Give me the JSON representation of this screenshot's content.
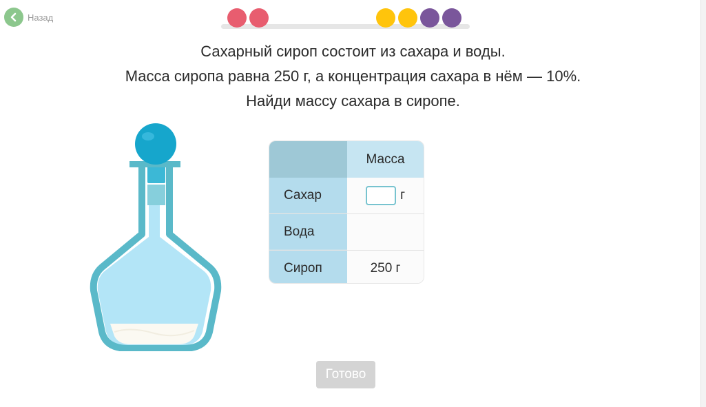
{
  "nav": {
    "back_label": "Назад"
  },
  "progress": {
    "dots": [
      {
        "color": "#e85d6f",
        "state": "incorrect"
      },
      {
        "color": "#e85d6f",
        "state": "incorrect"
      },
      {
        "color": "#ffc40c",
        "state": "correct"
      },
      {
        "color": "#ffc40c",
        "state": "correct"
      },
      {
        "color": "#7a569b",
        "state": "current"
      },
      {
        "color": "#7a569b",
        "state": "current"
      }
    ]
  },
  "task": {
    "line1": "Сахарный сироп состоит из сахара и воды.",
    "line2": "Масса сиропа равна 250 г, а концентрация сахара в нём — 10%.",
    "line3": "Найди массу сахара в сиропе."
  },
  "table": {
    "header": "Масса",
    "rows": [
      {
        "label": "Сахар",
        "value": "",
        "unit": "г"
      },
      {
        "label": "Вода",
        "value": ""
      },
      {
        "label": "Сироп",
        "value": "250 г"
      }
    ]
  },
  "actions": {
    "done_label": "Готово"
  },
  "colors": {
    "accent_green": "#8cc78d",
    "bottle_outline": "#5ab9c9",
    "liquid": "#b3e5f7",
    "stopper": "#1aa7cc"
  }
}
